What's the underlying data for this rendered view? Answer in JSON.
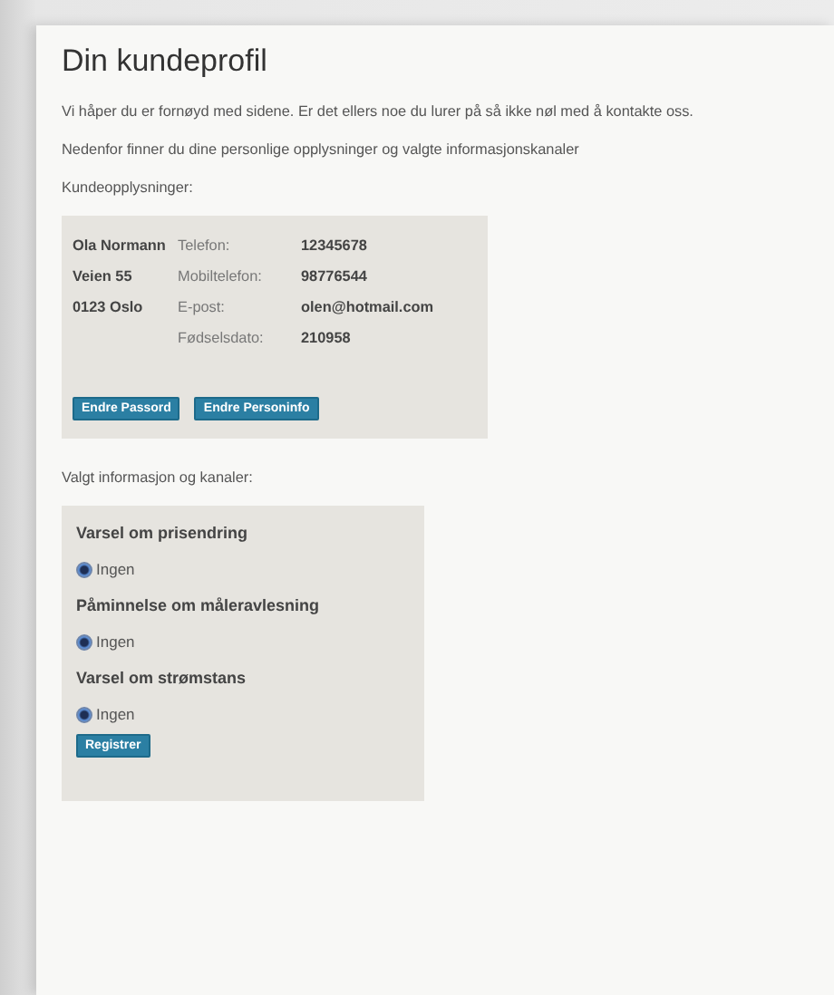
{
  "title": "Din kundeprofil",
  "intro": "Vi håper du er fornøyd med sidene. Er det ellers noe du lurer på så ikke nøl med å kontakte oss.",
  "subintro": "Nedenfor finner du dine personlige opplysninger og valgte informasjonskanaler",
  "customer_heading": "Kundeopplysninger:",
  "customer": {
    "address_lines": [
      "Ola Normann",
      "Veien 55",
      "0123 Oslo"
    ],
    "fields": [
      {
        "label": "Telefon:",
        "value": "12345678"
      },
      {
        "label": "Mobiltelefon:",
        "value": "98776544"
      },
      {
        "label": "E-post:",
        "value": "olen@hotmail.com"
      },
      {
        "label": "Fødselsdato:",
        "value": "210958"
      }
    ],
    "buttons": [
      "Endre Passord",
      "Endre Personinfo"
    ]
  },
  "channels_heading": "Valgt informasjon og kanaler:",
  "channels": [
    {
      "title": "Varsel om prisendring",
      "options": [
        {
          "label": "Ingen",
          "selected": true
        }
      ]
    },
    {
      "title": "Påminnelse om måleravlesning",
      "options": [
        {
          "label": "Ingen",
          "selected": true
        }
      ]
    },
    {
      "title": "Varsel om strømstans",
      "options": [
        {
          "label": "Ingen",
          "selected": true
        }
      ]
    }
  ],
  "submit": "Registrer"
}
